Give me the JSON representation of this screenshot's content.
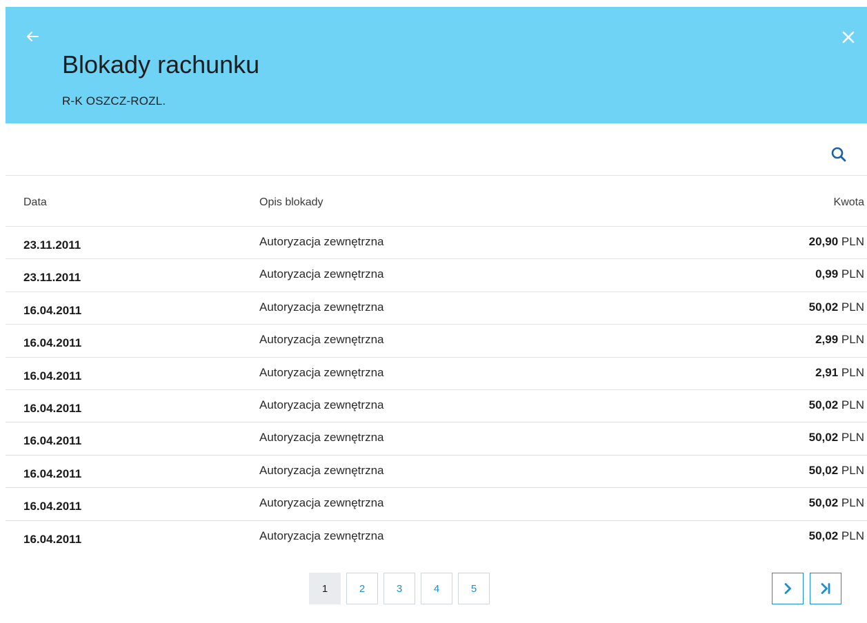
{
  "header": {
    "title": "Blokady rachunku",
    "subtitle": "R-K OSZCZ-ROZL.",
    "background_color": "#6fd3f5",
    "back_icon": "arrow-left-icon",
    "close_icon": "close-icon"
  },
  "toolbar": {
    "search_icon": "search-icon",
    "accent_color": "#1a5fa8"
  },
  "table": {
    "columns": {
      "date": "Data",
      "description": "Opis blokady",
      "amount": "Kwota"
    },
    "rows": [
      {
        "date": "23.11.2011",
        "description": "Autoryzacja zewnętrzna",
        "amount": "20,90",
        "currency": "PLN"
      },
      {
        "date": "23.11.2011",
        "description": "Autoryzacja zewnętrzna",
        "amount": "0,99",
        "currency": "PLN"
      },
      {
        "date": "16.04.2011",
        "description": "Autoryzacja zewnętrzna",
        "amount": "50,02",
        "currency": "PLN"
      },
      {
        "date": "16.04.2011",
        "description": "Autoryzacja zewnętrzna",
        "amount": "2,99",
        "currency": "PLN"
      },
      {
        "date": "16.04.2011",
        "description": "Autoryzacja zewnętrzna",
        "amount": "2,91",
        "currency": "PLN"
      },
      {
        "date": "16.04.2011",
        "description": "Autoryzacja zewnętrzna",
        "amount": "50,02",
        "currency": "PLN"
      },
      {
        "date": "16.04.2011",
        "description": "Autoryzacja zewnętrzna",
        "amount": "50,02",
        "currency": "PLN"
      },
      {
        "date": "16.04.2011",
        "description": "Autoryzacja zewnętrzna",
        "amount": "50,02",
        "currency": "PLN"
      },
      {
        "date": "16.04.2011",
        "description": "Autoryzacja zewnętrzna",
        "amount": "50,02",
        "currency": "PLN"
      },
      {
        "date": "16.04.2011",
        "description": "Autoryzacja zewnętrzna",
        "amount": "50,02",
        "currency": "PLN"
      }
    ]
  },
  "pagination": {
    "pages": [
      "1",
      "2",
      "3",
      "4",
      "5"
    ],
    "current": "1",
    "next_icon": "chevron-right-icon",
    "last_icon": "skip-to-last-icon",
    "accent_color": "#1a8fd0"
  }
}
